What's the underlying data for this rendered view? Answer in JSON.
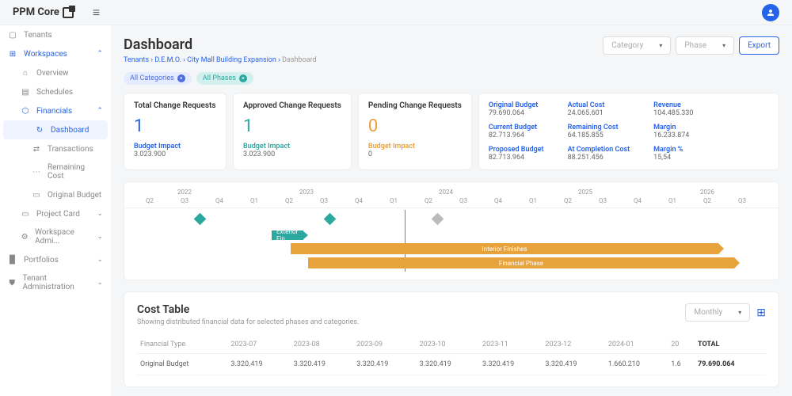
{
  "app": {
    "name": "PPM Core"
  },
  "topbar": {
    "avatar": "user"
  },
  "sidebar": {
    "items": [
      {
        "label": "Tenants",
        "icon": "building"
      },
      {
        "label": "Workspaces",
        "icon": "grid",
        "blue": true,
        "expanded": true
      },
      {
        "label": "Overview",
        "level": 2
      },
      {
        "label": "Schedules",
        "level": 2
      },
      {
        "label": "Financials",
        "level": 2,
        "blue": true,
        "expanded": true
      },
      {
        "label": "Dashboard",
        "level": 3,
        "active": true
      },
      {
        "label": "Transactions",
        "level": 3
      },
      {
        "label": "Remaining Cost",
        "level": 3
      },
      {
        "label": "Original Budget",
        "level": 3
      },
      {
        "label": "Project Card",
        "level": 2,
        "collapsed": true
      },
      {
        "label": "Workspace Admi...",
        "level": 2,
        "collapsed": true
      },
      {
        "label": "Portfolios",
        "icon": "folder",
        "collapsed": true
      },
      {
        "label": "Tenant Administration",
        "icon": "gear",
        "collapsed": true
      }
    ]
  },
  "header": {
    "title": "Dashboard",
    "breadcrumb": [
      "Tenants",
      "D.E.M.O.",
      "City Mall Building Expansion",
      "Dashboard"
    ],
    "dropdowns": {
      "category": "Category",
      "phase": "Phase"
    },
    "export": "Export"
  },
  "chips": [
    {
      "label": "All Categories",
      "style": "blue"
    },
    {
      "label": "All Phases",
      "style": "teal"
    }
  ],
  "requestCards": [
    {
      "title": "Total Change Requests",
      "value": "1",
      "color": "blue",
      "impactLabel": "Budget Impact",
      "impactVal": "3.023.900"
    },
    {
      "title": "Approved Change Requests",
      "value": "1",
      "color": "teal",
      "impactLabel": "Budget Impact",
      "impactVal": "3.023.900"
    },
    {
      "title": "Pending Change Requests",
      "value": "0",
      "color": "orange",
      "impactLabel": "Budget Impact",
      "impactVal": "0"
    }
  ],
  "metrics": {
    "col1": [
      {
        "label": "Original Budget",
        "val": "79.690.064"
      },
      {
        "label": "Current Budget",
        "val": "82.713.964"
      },
      {
        "label": "Proposed Budget",
        "val": "82.713.964"
      }
    ],
    "col2": [
      {
        "label": "Actual Cost",
        "val": "24.065.601"
      },
      {
        "label": "Remaining Cost",
        "val": "64.185.855"
      },
      {
        "label": "At Completion Cost",
        "val": "88.251.456"
      }
    ],
    "col3": [
      {
        "label": "Revenue",
        "val": "104.485.330"
      },
      {
        "label": "Margin",
        "val": "16.233.874"
      },
      {
        "label": "Margin %",
        "val": "15,54"
      }
    ]
  },
  "timeline": {
    "years": [
      {
        "year": "2022",
        "quarters": [
          "Q2",
          "Q3",
          "Q4"
        ]
      },
      {
        "year": "2023",
        "quarters": [
          "Q1",
          "Q2",
          "Q3",
          "Q4"
        ]
      },
      {
        "year": "2024",
        "quarters": [
          "Q1",
          "Q2",
          "Q3",
          "Q4"
        ]
      },
      {
        "year": "2025",
        "quarters": [
          "Q1",
          "Q2",
          "Q3",
          "Q4"
        ]
      },
      {
        "year": "2026",
        "quarters": [
          "Q1",
          "Q2",
          "Q3"
        ]
      }
    ],
    "bars": {
      "exterior": "Exterior Fin...",
      "interior": "Interior Finishes",
      "financial": "Financial Phase"
    }
  },
  "costTable": {
    "title": "Cost Table",
    "subtitle": "Showing distributed financial data for selected phases and categories.",
    "granularity": "Monthly",
    "headers": [
      "Financial Type",
      "2023-07",
      "2023-08",
      "2023-09",
      "2023-10",
      "2023-11",
      "2023-12",
      "2024-01",
      "20",
      "TOTAL"
    ],
    "rows": [
      [
        "Original Budget",
        "3.320.419",
        "3.320.419",
        "3.320.419",
        "3.320.419",
        "3.320.419",
        "3.320.419",
        "1.660.210",
        "1.6",
        "79.690.064"
      ]
    ]
  }
}
